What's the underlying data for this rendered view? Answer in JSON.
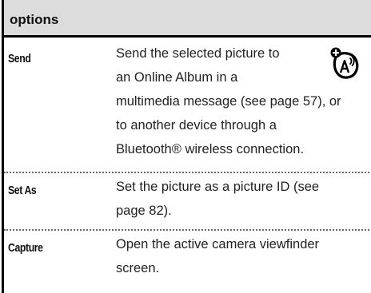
{
  "table": {
    "header": "options",
    "rows": [
      {
        "label": "Send",
        "lines": [
          "Send the selected picture to",
          "an Online Album in a",
          "multimedia message (see page 57), or",
          "to another device through a",
          "Bluetooth®  wireless connection."
        ],
        "icon": "network-feature-icon"
      },
      {
        "label": "Set As",
        "lines": [
          "Set the picture as a picture ID (see",
          "page 82)."
        ]
      },
      {
        "label": "Capture",
        "lines": [
          "Open the active camera viewfinder",
          "screen."
        ]
      }
    ]
  }
}
